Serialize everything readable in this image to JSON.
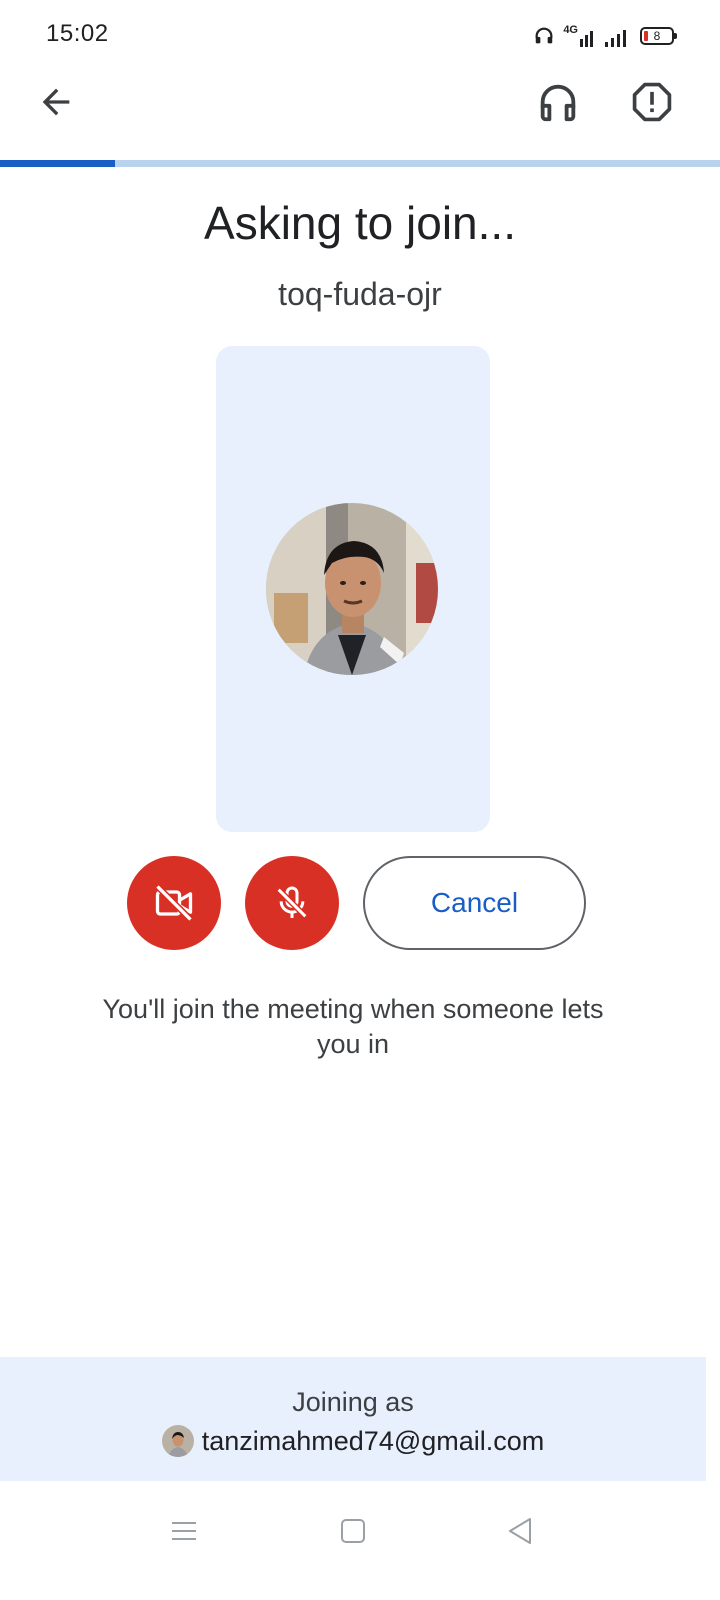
{
  "status_bar": {
    "time": "15:02",
    "network": "4G",
    "battery_level": "8",
    "icons": [
      "headset-status-icon",
      "signal-4g-icon",
      "signal-icon",
      "battery-icon"
    ]
  },
  "app_bar": {
    "back_icon": "arrow-back-icon",
    "headset_icon": "headset-icon",
    "report_icon": "report-icon"
  },
  "progress": {
    "value": 0.16,
    "color": "#1a5dc4",
    "track_color": "#b9d3ee"
  },
  "main": {
    "title": "Asking to join...",
    "meeting_code": "toq-fuda-ojr",
    "info": "You'll join the meeting when someone lets you in"
  },
  "controls": {
    "camera_icon": "videocam-off-icon",
    "mic_icon": "mic-off-icon",
    "cancel_label": "Cancel",
    "accent": "#d93025"
  },
  "footer": {
    "joining_label": "Joining as",
    "email": "tanzimahmed74@gmail.com"
  },
  "nav_bar": {
    "icons": [
      "menu-icon",
      "home-icon",
      "back-triangle-icon"
    ]
  },
  "colors": {
    "brand_blue": "#1a5dc4",
    "panel_bg": "#e8f0fd",
    "danger_red": "#d93025"
  }
}
